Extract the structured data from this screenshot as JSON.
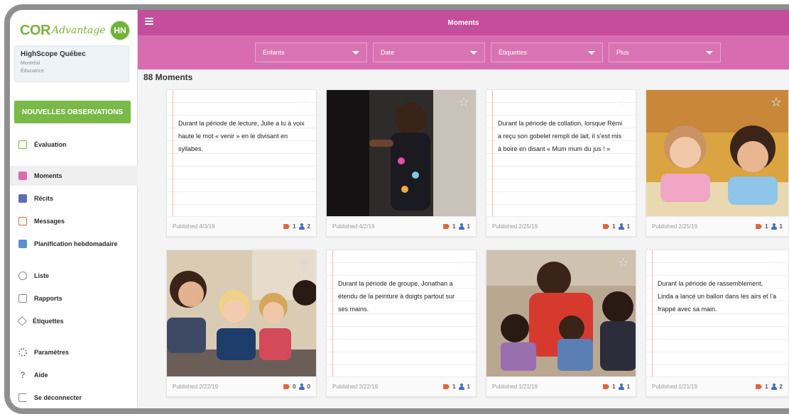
{
  "brand": {
    "cor": "COR",
    "advantage": "Advantage"
  },
  "user": {
    "initials": "HN"
  },
  "org": {
    "name": "HighScope Québec",
    "city": "Montréal",
    "role": "Éducatrice"
  },
  "sidebar": {
    "new_observation_label": "NOUVELLES OBSERVATIONS",
    "items": [
      {
        "label": "Évaluation",
        "icon": "clipboard-icon",
        "color": "#7ab848"
      },
      {
        "label": "Moments",
        "icon": "photo-icon",
        "color": "#d76db0"
      },
      {
        "label": "Récits",
        "icon": "stories-icon",
        "color": "#5a6fb5"
      },
      {
        "label": "Messages",
        "icon": "envelope-icon",
        "color": "#e1663a"
      },
      {
        "label": "Planification hebdomadaire",
        "icon": "calendar-icon",
        "color": "#5a8fd0"
      },
      {
        "label": "Liste",
        "icon": "people-icon",
        "color": "#888888"
      },
      {
        "label": "Rapports",
        "icon": "chart-icon",
        "color": "#888888"
      },
      {
        "label": "Étiquettes",
        "icon": "tag-icon",
        "color": "#888888"
      },
      {
        "label": "Paramètres",
        "icon": "gear-icon",
        "color": "#888888"
      },
      {
        "label": "Aide",
        "icon": "help-icon",
        "color": "#888888"
      },
      {
        "label": "Se déconnecter",
        "icon": "logout-icon",
        "color": "#888888"
      }
    ]
  },
  "header": {
    "title": "Moments"
  },
  "filters": [
    {
      "label": "Enfants"
    },
    {
      "label": "Date"
    },
    {
      "label": "Étiquettes"
    },
    {
      "label": "Plus"
    }
  ],
  "main": {
    "count_title": "88 Moments"
  },
  "moments": [
    {
      "kind": "text",
      "text": "Durant la période de lecture, Julie a lu à voix haute le mot « venir » en le divisant en syllabes.",
      "published": "Published 4/3/19",
      "tags": "1",
      "children": "2"
    },
    {
      "kind": "photo",
      "photo": "child-dancing-photo",
      "published": "Published 4/2/19",
      "tags": "1",
      "children": "1"
    },
    {
      "kind": "text",
      "text": "Durant la période de collation, lorsque Rémi a reçu son gobelet rempli de lait, il s’est mis à boire en disant « Mum mum du jus ! »",
      "published": "Published 2/25/19",
      "tags": "1",
      "children": "1"
    },
    {
      "kind": "photo",
      "photo": "girls-drawing-photo",
      "published": "Published 2/25/19",
      "tags": "1",
      "children": "1"
    },
    {
      "kind": "photo",
      "photo": "teacher-with-children-photo",
      "published": "Published 2/22/19",
      "tags": "0",
      "children": "0"
    },
    {
      "kind": "text",
      "text": "Durant la période de groupe, Jonathan a étendu de la peinture à doigts partout sur ses mains.",
      "published": "Published 2/22/19",
      "tags": "1",
      "children": "1"
    },
    {
      "kind": "photo",
      "photo": "reading-together-photo",
      "published": "Published 1/21/19",
      "tags": "1",
      "children": "1"
    },
    {
      "kind": "text",
      "text": "Durant la période de rassemblement, Linda a lancé un ballon dans les airs et l’a frappé avec sa main.",
      "published": "Published 1/21/19",
      "tags": "1",
      "children": "2"
    }
  ],
  "colors": {
    "topbar": "#c44e9c",
    "filterbar": "#d76db0",
    "accent_green": "#7ab848"
  }
}
